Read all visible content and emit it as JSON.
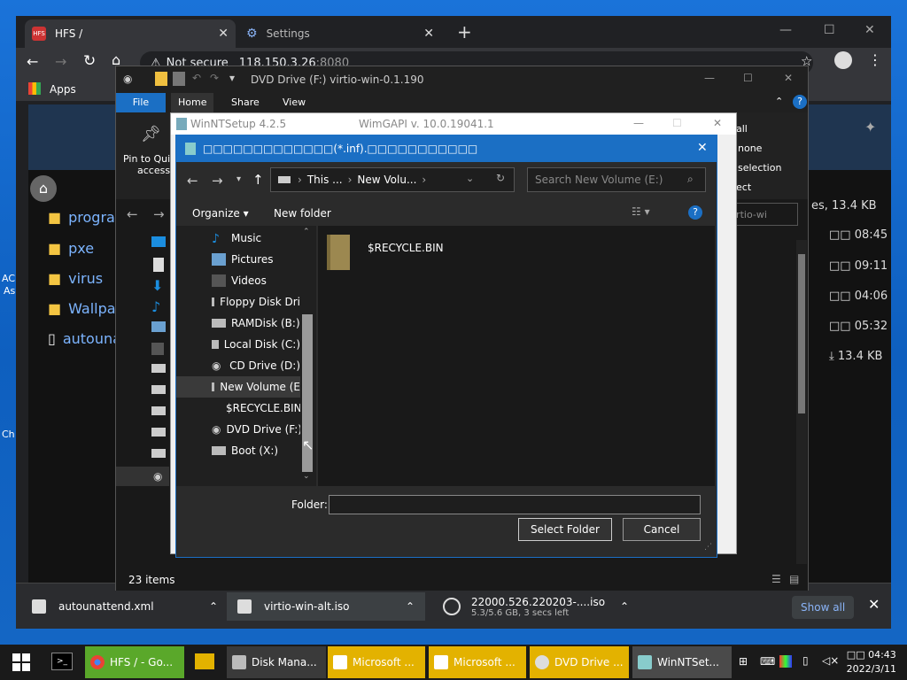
{
  "desktop": {
    "left_label_1": "AC",
    "left_label_2": "As",
    "left_label_3": "Ch"
  },
  "chrome": {
    "tabs": [
      {
        "label": "HFS /",
        "icon": "hfs-icon"
      },
      {
        "label": "Settings",
        "icon": "gear-icon"
      }
    ],
    "address": {
      "secure_label": "Not secure",
      "url": "118.150.3.26",
      "port": ":8080"
    },
    "bookmarks": {
      "apps_label": "Apps"
    },
    "downloads": [
      {
        "name": "autounattend.xml"
      },
      {
        "name": "virtio-win-alt.iso"
      },
      {
        "name": "22000.526.220203-....iso",
        "progress": "5.3/5.6 GB, 3 secs left"
      }
    ],
    "show_all": "Show all"
  },
  "hfs": {
    "items": [
      "programs",
      "pxe",
      "virus",
      "Wallpape",
      "autounat"
    ],
    "right_header": "es, 13.4 KB",
    "times": [
      "□□ 08:45",
      "□□ 09:11",
      "□□ 04:06",
      "□□ 05:32"
    ],
    "file_size": "13.4 KB"
  },
  "explorer": {
    "title": "DVD Drive (F:) virtio-win-0.1.190",
    "ribbon_tabs": [
      "File",
      "Home",
      "Share",
      "View"
    ],
    "pin_label_1": "Pin to Quic",
    "pin_label_2": "access",
    "select_all": "all",
    "select_none": "none",
    "invert_selection": "selection",
    "select_label": "ect",
    "search_hint": "irtio-wi",
    "status": "23 items"
  },
  "winnt": {
    "title": "WinNTSetup 4.2.5",
    "subtitle": "WimGAPI v. 10.0.19041.1"
  },
  "dialog": {
    "title": "□□□□□□□□□□□□□(*.inf).□□□□□□□□□□□",
    "breadcrumb": [
      "This ...",
      "New Volu..."
    ],
    "search_placeholder": "Search New Volume (E:)",
    "organize": "Organize",
    "new_folder": "New folder",
    "tree": [
      {
        "label": "Music",
        "icon": "music-icon"
      },
      {
        "label": "Pictures",
        "icon": "pictures-icon"
      },
      {
        "label": "Videos",
        "icon": "videos-icon"
      },
      {
        "label": "Floppy Disk Dri",
        "icon": "drive-icon"
      },
      {
        "label": "RAMDisk (B:)",
        "icon": "drive-icon"
      },
      {
        "label": "Local Disk (C:)",
        "icon": "drive-icon"
      },
      {
        "label": "CD Drive (D:)",
        "icon": "cd-drive-icon"
      },
      {
        "label": "New Volume (E",
        "icon": "drive-icon"
      },
      {
        "label": "$RECYCLE.BIN",
        "icon": "folder-icon"
      },
      {
        "label": "DVD Drive (F:) v",
        "icon": "dvd-icon"
      },
      {
        "label": "Boot (X:)",
        "icon": "drive-icon"
      }
    ],
    "files": [
      {
        "label": "$RECYCLE.BIN"
      }
    ],
    "folder_label": "Folder:",
    "folder_value": "",
    "select_button": "Select Folder",
    "cancel_button": "Cancel"
  },
  "taskbar": {
    "items": [
      "HFS / - Go...",
      "Disk Mana...",
      "Microsoft ...",
      "Microsoft ...",
      "DVD Drive ...",
      "WinNTSet..."
    ],
    "time": "□□ 04:43",
    "date": "2022/3/11"
  },
  "colors": {
    "accent": "#1b6fc4",
    "taskbar_yellow": "#e3b200",
    "taskbar_green": "#5aa82a"
  }
}
